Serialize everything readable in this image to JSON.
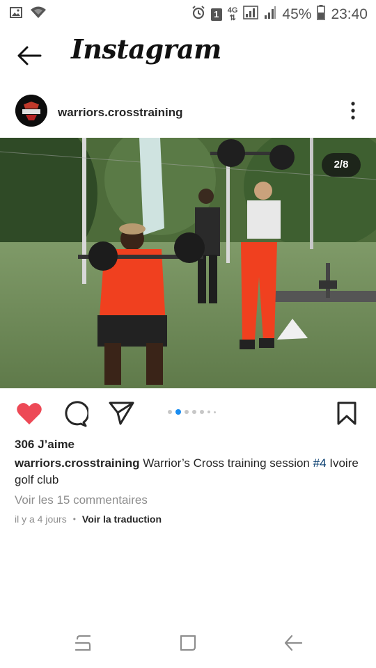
{
  "status_bar": {
    "battery": "45%",
    "time": "23:40",
    "notification_count": "1",
    "network": "4G"
  },
  "header": {
    "brand": "Instagram"
  },
  "post": {
    "username": "warriors.crosstraining",
    "avatar_text": "WARRIORS CROSS TRAINING",
    "image_counter": "2/8",
    "carousel_total_dots": 7,
    "carousel_active_index": 1,
    "likes": "306 J’aime",
    "caption_user": "warriors.crosstraining",
    "caption_text_before": " Warrior’s Cross training session ",
    "caption_hashtag": "#4",
    "caption_text_after": " Ivoire golf club",
    "view_comments": "Voir les 15 commentaires",
    "time_ago": "il y a 4 jours",
    "separator": "•",
    "see_translation": "Voir la traduction"
  },
  "icons": {
    "back": "back-arrow-icon",
    "more": "more-vertical-icon",
    "like": "heart-icon",
    "comment": "comment-icon",
    "share": "send-icon",
    "save": "bookmark-icon"
  },
  "colors": {
    "like_red": "#ed4956",
    "hashtag_blue": "#00376b",
    "active_dot": "#1a8cf0",
    "muted_text": "#8e8e8e"
  }
}
